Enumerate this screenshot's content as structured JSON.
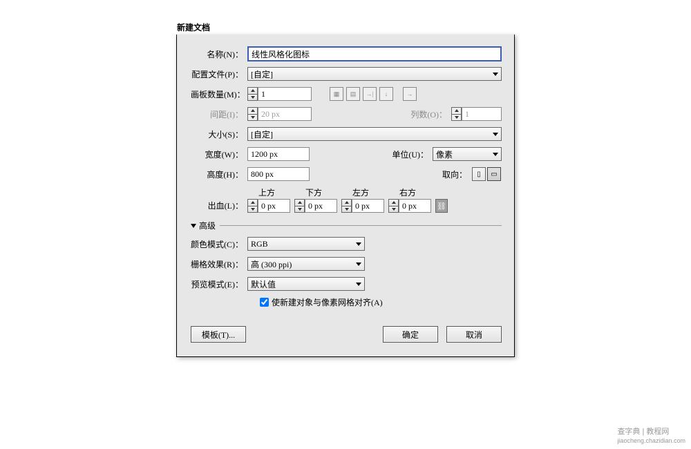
{
  "dialog": {
    "title": "新建文档",
    "name_label": "名称(N)：",
    "name_value": "线性风格化图标",
    "profile_label": "配置文件(P)：",
    "profile_value": "[自定]",
    "artboards_label": "画板数量(M)：",
    "artboards_value": "1",
    "spacing_label": "间距(I)：",
    "spacing_value": "20 px",
    "columns_label": "列数(O)：",
    "columns_value": "1",
    "size_label": "大小(S)：",
    "size_value": "[自定]",
    "width_label": "宽度(W)：",
    "width_value": "1200 px",
    "units_label": "单位(U)：",
    "units_value": "像素",
    "height_label": "高度(H)：",
    "height_value": "800 px",
    "orientation_label": "取向：",
    "bleed_label": "出血(L)：",
    "bleed_top": "上方",
    "bleed_bottom": "下方",
    "bleed_left": "左方",
    "bleed_right": "右方",
    "bleed_value": "0 px",
    "advanced_label": "高级",
    "color_mode_label": "颜色模式(C)：",
    "color_mode_value": "RGB",
    "raster_label": "栅格效果(R)：",
    "raster_value": "高 (300 ppi)",
    "preview_label": "预览模式(E)：",
    "preview_value": "默认值",
    "align_checkbox_label": "使新建对象与像素网格对齐(A)",
    "align_checked": true,
    "template_btn": "模板(T)...",
    "ok_btn": "确定",
    "cancel_btn": "取消"
  },
  "watermark": {
    "brand": "查字典",
    "site": "教程网",
    "url": "jiaocheng.chazidian.com"
  }
}
